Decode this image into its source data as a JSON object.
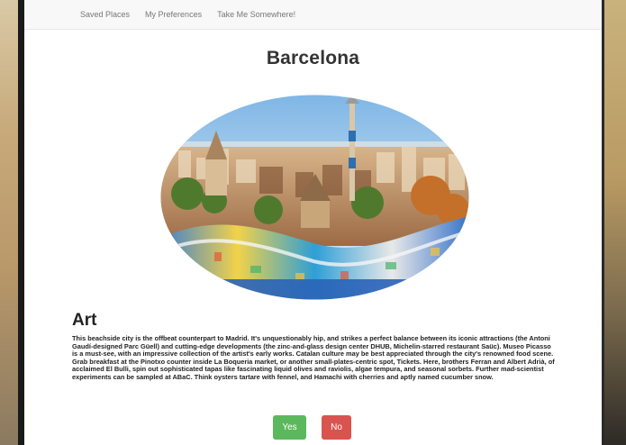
{
  "nav": {
    "items": [
      {
        "label": "Saved Places"
      },
      {
        "label": "My Preferences"
      },
      {
        "label": "Take Me Somewhere!"
      }
    ]
  },
  "destination": {
    "title": "Barcelona"
  },
  "section": {
    "heading": "Art",
    "description": "This beachside city is the offbeat counterpart to Madrid. It's unquestionably hip, and strikes a perfect balance between its iconic attractions (the Antoni Gaudí-designed Parc Güell) and cutting-edge developments (the zinc-and-glass design center DHUB, Michelin-starred restaurant Saüc). Museo Picasso is a must-see, with an impressive collection of the artist's early works. Catalan culture may be best appreciated through the city's renowned food scene. Grab breakfast at the Pinotxo counter inside La Boqueria market, or another small-plates-centric spot, Tickets. Here, brothers Ferran and Albert Adrià, of acclaimed El Bulli, spin out sophisticated tapas like fascinating liquid olives and raviolis, algae tempura, and seasonal sorbets. Further mad-scientist experiments can be sampled at ABaC. Think oysters tartare with fennel, and Hamachi with cherries and aptly named cucumber snow."
  },
  "actions": {
    "yes_label": "Yes",
    "no_label": "No"
  },
  "colors": {
    "yes": "#5cb85c",
    "no": "#d9534f",
    "navbar": "#f8f8f8"
  }
}
